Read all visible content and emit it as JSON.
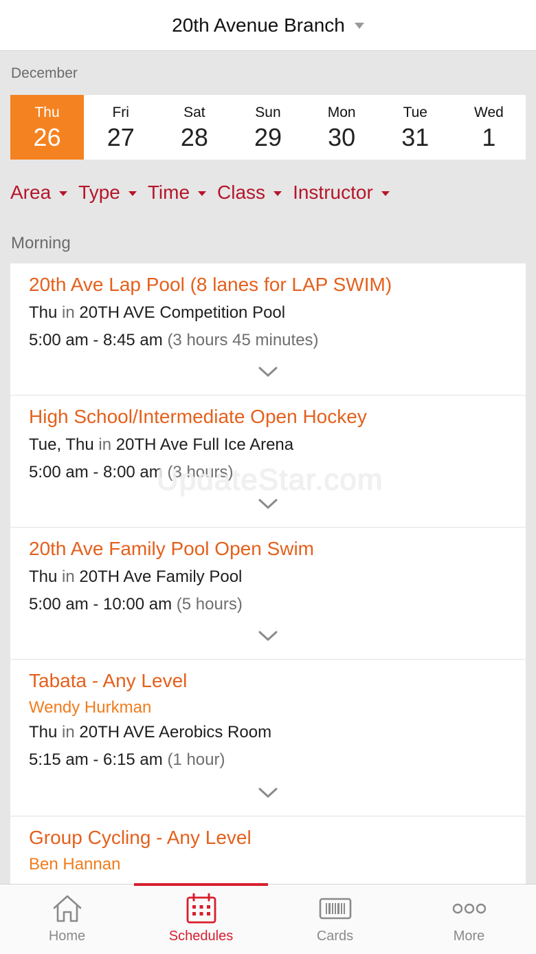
{
  "header": {
    "title": "20th Avenue Branch"
  },
  "calendar": {
    "month": "December",
    "days": [
      {
        "name": "Thu",
        "num": "26",
        "active": true
      },
      {
        "name": "Fri",
        "num": "27"
      },
      {
        "name": "Sat",
        "num": "28"
      },
      {
        "name": "Sun",
        "num": "29"
      },
      {
        "name": "Mon",
        "num": "30"
      },
      {
        "name": "Tue",
        "num": "31"
      },
      {
        "name": "Wed",
        "num": "1"
      }
    ]
  },
  "filters": [
    "Area",
    "Type",
    "Time",
    "Class",
    "Instructor"
  ],
  "section": "Morning",
  "classes": [
    {
      "title": "20th Ave Lap Pool (8 lanes for LAP SWIM)",
      "days": "Thu",
      "in": "in",
      "location": "20TH AVE Competition Pool",
      "time": "5:00 am - 8:45 am",
      "duration": "(3 hours 45 minutes)"
    },
    {
      "title": "High School/Intermediate Open Hockey",
      "days": "Tue, Thu",
      "in": "in",
      "location": "20TH Ave Full Ice Arena",
      "time": "5:00 am - 8:00 am",
      "duration": "(3 hours)"
    },
    {
      "title": "20th Ave Family Pool Open Swim",
      "days": "Thu",
      "in": "in",
      "location": "20TH Ave Family Pool",
      "time": "5:00 am - 10:00 am",
      "duration": "(5 hours)"
    },
    {
      "title": "Tabata - Any Level",
      "instructor": "Wendy Hurkman",
      "days": "Thu",
      "in": "in",
      "location": "20TH AVE Aerobics Room",
      "time": "5:15 am - 6:15 am",
      "duration": "(1 hour)"
    },
    {
      "title": "Group Cycling - Any Level",
      "instructor": "Ben Hannan"
    }
  ],
  "watermark": "UpdateStar.com",
  "tabbar": {
    "tabs": [
      {
        "label": "Home",
        "icon": "home-icon"
      },
      {
        "label": "Schedules",
        "icon": "calendar-icon",
        "active": true
      },
      {
        "label": "Cards",
        "icon": "barcode-card-icon"
      },
      {
        "label": "More",
        "icon": "more-dots-icon"
      }
    ]
  },
  "colors": {
    "accent": "#f58220",
    "filter": "#b5152b",
    "title": "#e4601c",
    "tab_active": "#d71f2e"
  }
}
